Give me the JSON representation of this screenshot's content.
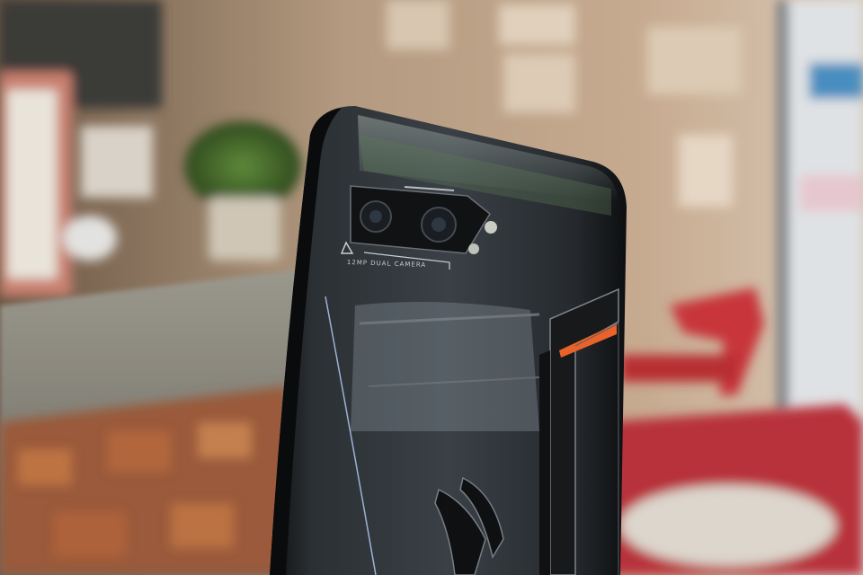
{
  "photo": {
    "camera_label": "12MP DUAL CAMERA"
  },
  "colors": {
    "wall": "#bfa387",
    "counter": "#8c8a80",
    "phone_body": "#1e2226",
    "accent_orange": "#e8622a",
    "chair_red": "#c8353a"
  }
}
